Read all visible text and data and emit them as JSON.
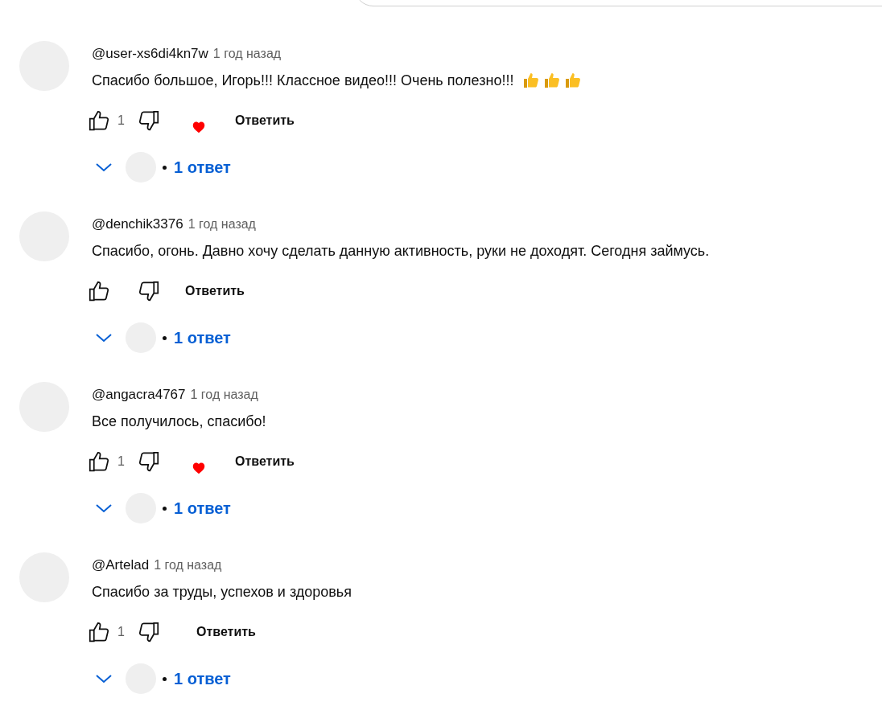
{
  "comments": [
    {
      "author": "@user-xs6di4kn7w",
      "time": "1 год назад",
      "text": "Спасибо большое, Игорь!!! Классное видео!!! Очень полезно!!!",
      "reactions": [
        {
          "kind": "thumbs-up"
        },
        {
          "kind": "thumbs-up"
        },
        {
          "kind": "thumbs-up"
        }
      ],
      "likes": "1",
      "hearted": true,
      "reply_label": "Ответить",
      "replies": "1 ответ"
    },
    {
      "author": "@denchik3376",
      "time": "1 год назад",
      "text": "Спасибо, огонь. Давно хочу сделать данную активность, руки не доходят. Сегодня займусь.",
      "hearted": false,
      "reply_label": "Ответить",
      "replies": "1 ответ"
    },
    {
      "author": "@angacra4767",
      "time": "1 год назад",
      "text": "Все получилось, спасибо!",
      "likes": "1",
      "hearted": true,
      "reply_label": "Ответить",
      "replies": "1 ответ"
    },
    {
      "author": "@Artelad",
      "time": "1 год назад",
      "text": "Спасибо за труды, успехов и здоровья",
      "likes": "1",
      "hearted": false,
      "reply_label": "Ответить",
      "replies": "1 ответ"
    }
  ]
}
